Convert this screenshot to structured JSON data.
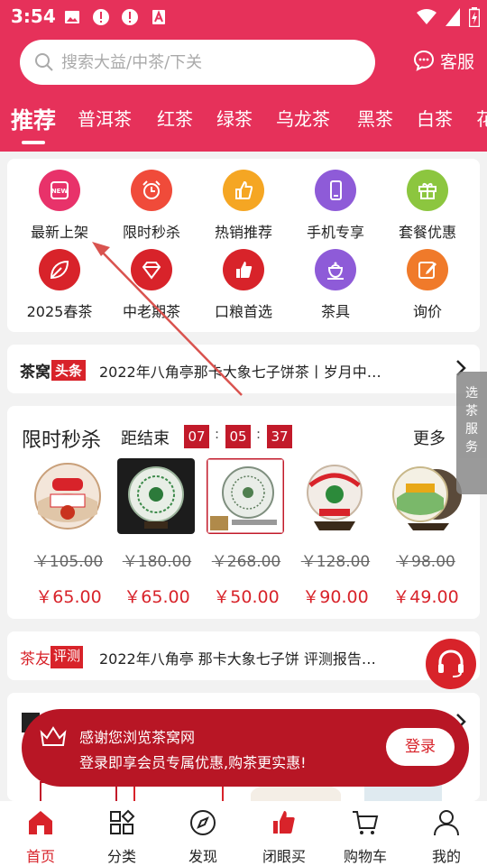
{
  "status": {
    "time": "3:54"
  },
  "search": {
    "placeholder": "搜索大益/中茶/下关"
  },
  "header": {
    "service_label": "客服"
  },
  "categories": [
    "推荐",
    "普洱茶",
    "红茶",
    "绿茶",
    "乌龙茶",
    "黑茶",
    "白茶",
    "花"
  ],
  "quick_links": [
    {
      "label": "最新上架",
      "icon": "new-icon",
      "color": "#e8326a"
    },
    {
      "label": "限时秒杀",
      "icon": "alarm-clock-icon",
      "color": "#f04b3a"
    },
    {
      "label": "热销推荐",
      "icon": "thumbs-up-icon",
      "color": "#f5a623"
    },
    {
      "label": "手机专享",
      "icon": "phone-icon",
      "color": "#8e5bd8"
    },
    {
      "label": "套餐优惠",
      "icon": "gift-icon",
      "color": "#8cc63f"
    },
    {
      "label": "2025春茶",
      "icon": "leaf-icon",
      "color": "#d8232a"
    },
    {
      "label": "中老期茶",
      "icon": "diamond-icon",
      "color": "#d8232a"
    },
    {
      "label": "口粮首选",
      "icon": "like-icon",
      "color": "#d8232a"
    },
    {
      "label": "茶具",
      "icon": "teapot-icon",
      "color": "#8e5bd8"
    },
    {
      "label": "询价",
      "icon": "edit-icon",
      "color": "#f07a2a"
    }
  ],
  "news": {
    "tag": "茶窝",
    "tag_highlight": "头条",
    "text": "2022年八角亭那卡大象七子饼茶丨岁月中…"
  },
  "flash_sale": {
    "title": "限时秒杀",
    "ends_label": "距结束",
    "countdown": [
      "07",
      "05",
      "37"
    ],
    "more_label": "更多",
    "products": [
      {
        "original": "￥105.00",
        "price": "￥65.00"
      },
      {
        "original": "￥180.00",
        "price": "￥65.00"
      },
      {
        "original": "￥268.00",
        "price": "￥50.00"
      },
      {
        "original": "￥128.00",
        "price": "￥90.00"
      },
      {
        "original": "￥98.00",
        "price": "￥49.00"
      }
    ]
  },
  "review": {
    "tag": "茶友",
    "tag_highlight": "评测",
    "text": "2022年八角亭 那卡大象七子饼 评测报告…"
  },
  "side_float": {
    "label": "选茶服务"
  },
  "login_banner": {
    "line1": "感谢您浏览茶窝网",
    "line2": "登录即享会员专属优惠,购茶更实惠!",
    "button": "登录"
  },
  "bottom_nav": [
    {
      "label": "首页",
      "icon": "home-icon"
    },
    {
      "label": "分类",
      "icon": "category-icon"
    },
    {
      "label": "发现",
      "icon": "compass-icon"
    },
    {
      "label": "闭眼买",
      "icon": "thumbs-up-icon"
    },
    {
      "label": "购物车",
      "icon": "cart-icon"
    },
    {
      "label": "我的",
      "icon": "user-icon"
    }
  ],
  "colors": {
    "brand": "#e6315a",
    "accent": "#d8232a"
  }
}
